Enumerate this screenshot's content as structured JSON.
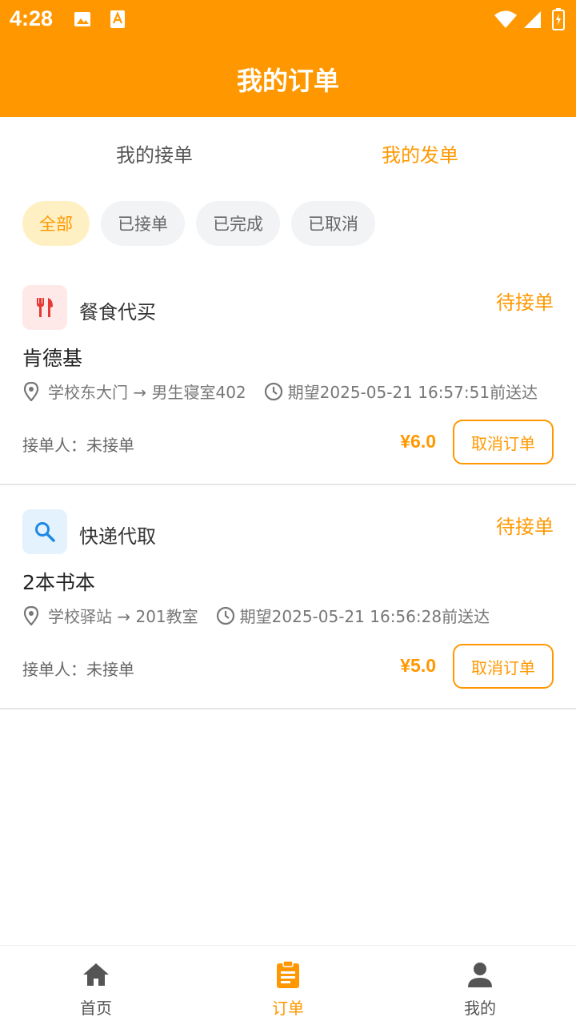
{
  "status_bar": {
    "time": "4:28"
  },
  "header": {
    "title": "我的订单"
  },
  "tabs": [
    {
      "label": "我的接单",
      "active": false
    },
    {
      "label": "我的发单",
      "active": true
    }
  ],
  "filters": [
    {
      "label": "全部",
      "active": true
    },
    {
      "label": "已接单",
      "active": false
    },
    {
      "label": "已完成",
      "active": false
    },
    {
      "label": "已取消",
      "active": false
    }
  ],
  "orders": [
    {
      "category": "餐食代买",
      "category_icon": "fork-knife-icon",
      "status": "待接单",
      "title": "肯德基",
      "route": "学校东大门 → 男生寝室402",
      "expected": "期望2025-05-21 16:57:51前送达",
      "taker": "接单人：未接单",
      "price": "¥6.0",
      "action": "取消订单"
    },
    {
      "category": "快递代取",
      "category_icon": "search-icon",
      "status": "待接单",
      "title": "2本书本",
      "route": "学校驿站 → 201教室",
      "expected": "期望2025-05-21 16:56:28前送达",
      "taker": "接单人：未接单",
      "price": "¥5.0",
      "action": "取消订单"
    }
  ],
  "bottom_nav": [
    {
      "label": "首页",
      "icon": "home-icon",
      "active": false
    },
    {
      "label": "订单",
      "icon": "clipboard-icon",
      "active": true
    },
    {
      "label": "我的",
      "icon": "person-icon",
      "active": false
    }
  ],
  "colors": {
    "accent": "#FF9800",
    "food_icon": "#E53935",
    "express_icon": "#1E88E5"
  }
}
